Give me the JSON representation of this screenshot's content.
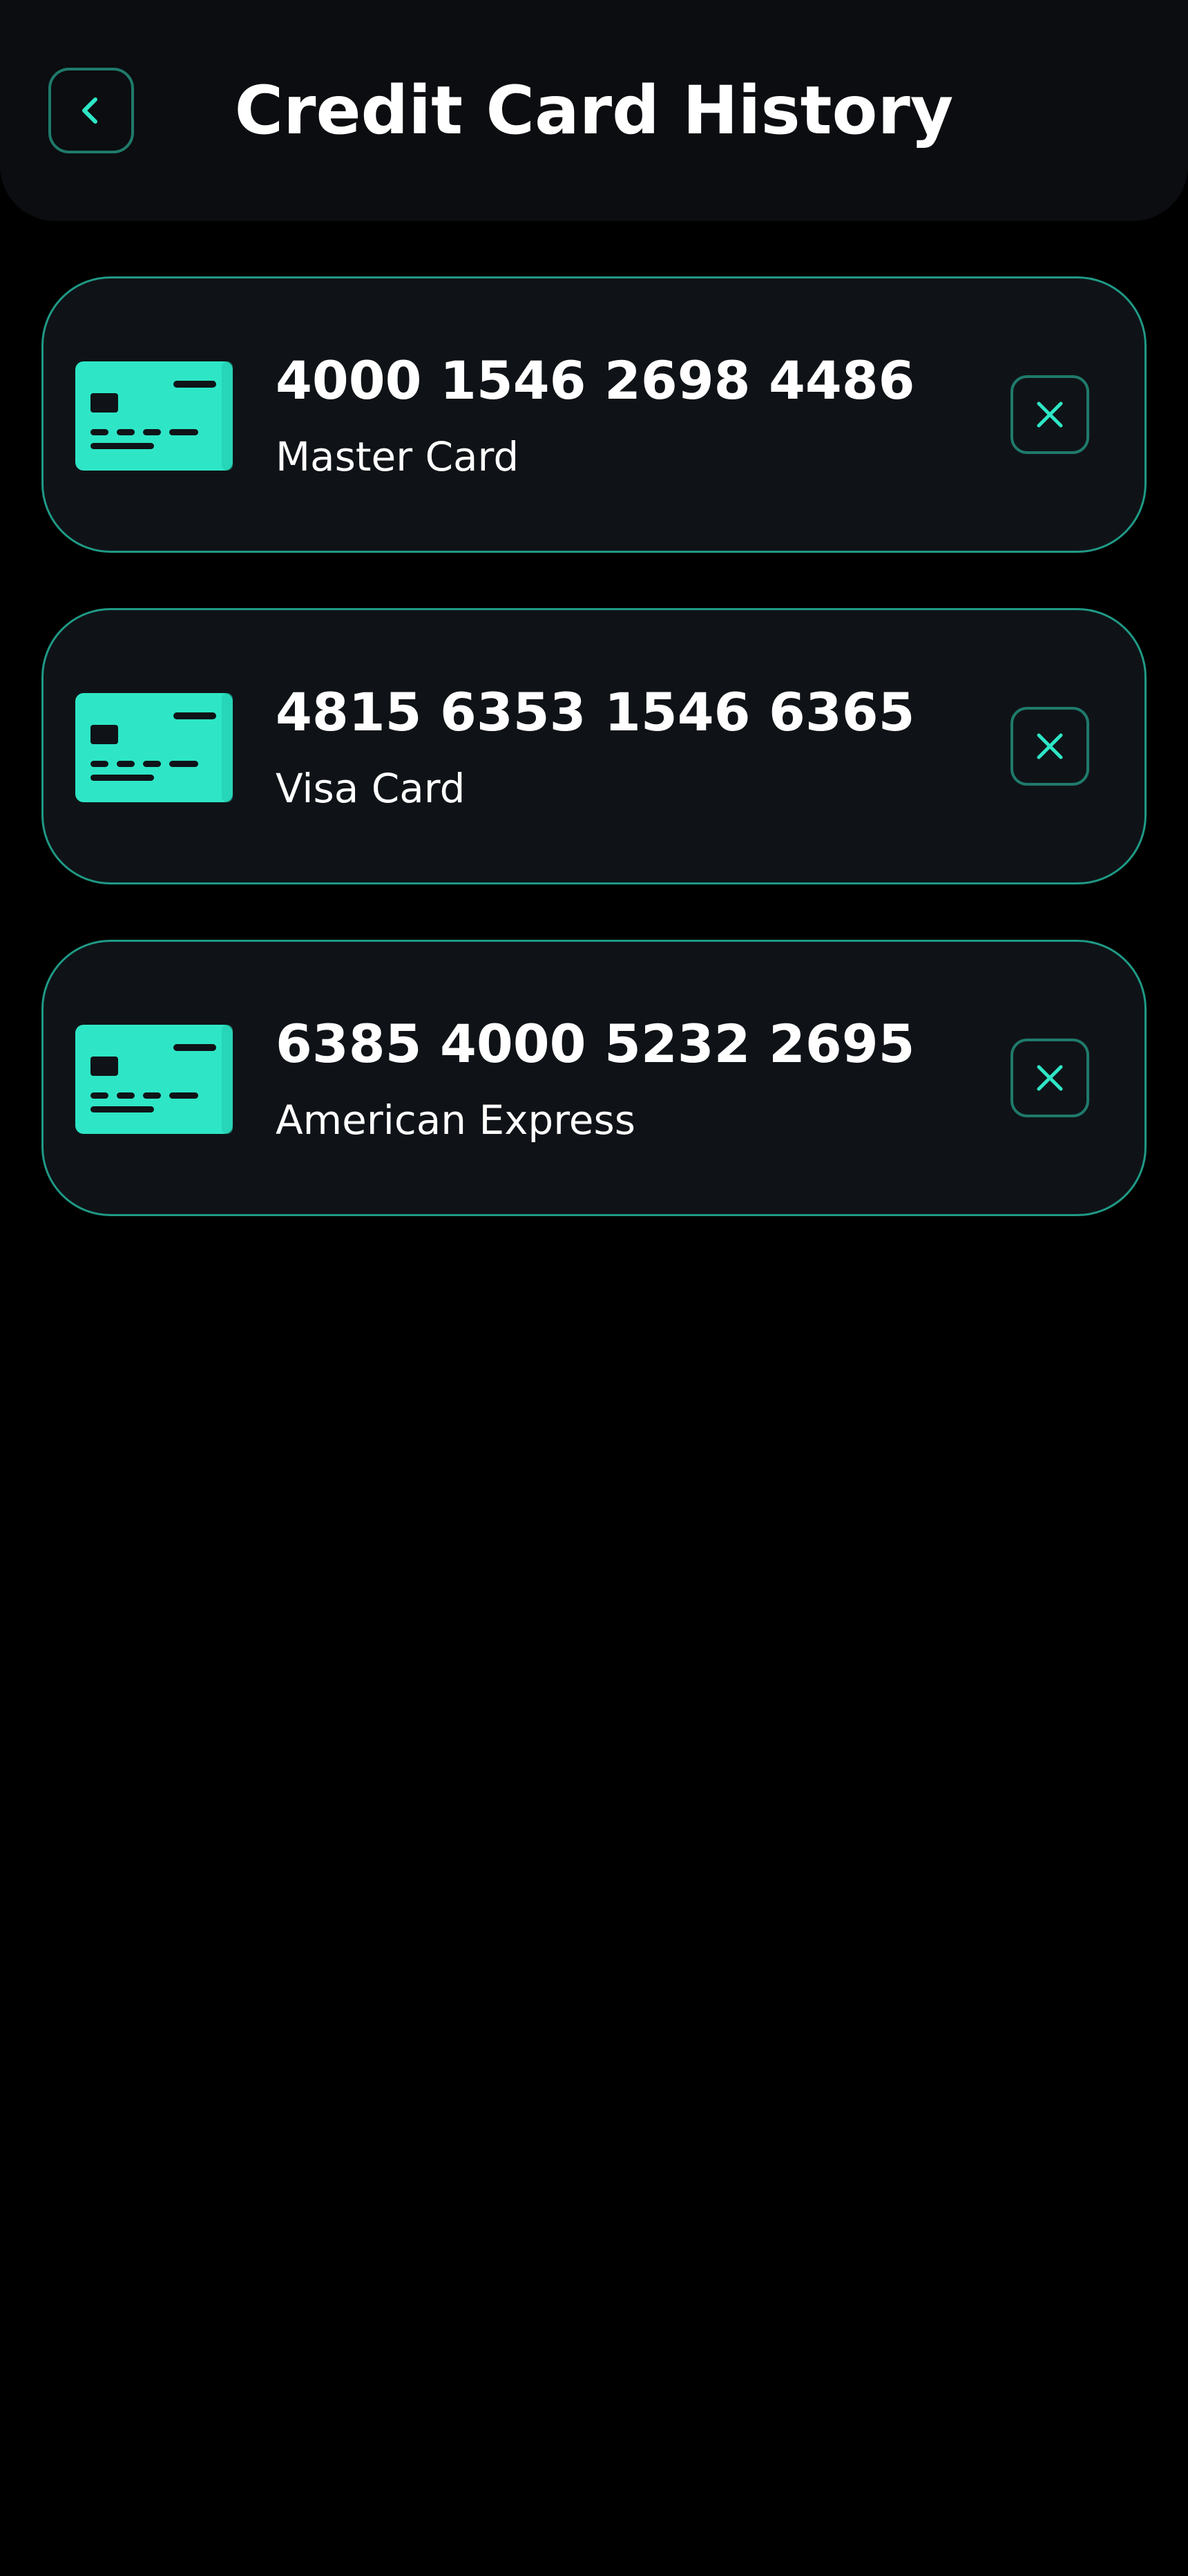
{
  "header": {
    "title": "Credit Card History",
    "back_icon": "chevron-left-icon"
  },
  "theme": {
    "accent": "#2ee6c6",
    "accent_border": "#1f9a86",
    "background": "#000000",
    "surface": "#0f1317",
    "header_bg": "#0b0d10"
  },
  "cards": [
    {
      "number": "4000 1546 2698 4486",
      "type": "Master Card",
      "icon": "credit-card-icon",
      "remove_icon": "close-icon"
    },
    {
      "number": "4815 6353 1546 6365",
      "type": "Visa Card",
      "icon": "credit-card-icon",
      "remove_icon": "close-icon"
    },
    {
      "number": "6385 4000 5232 2695",
      "type": "American Express",
      "icon": "credit-card-icon",
      "remove_icon": "close-icon"
    }
  ]
}
